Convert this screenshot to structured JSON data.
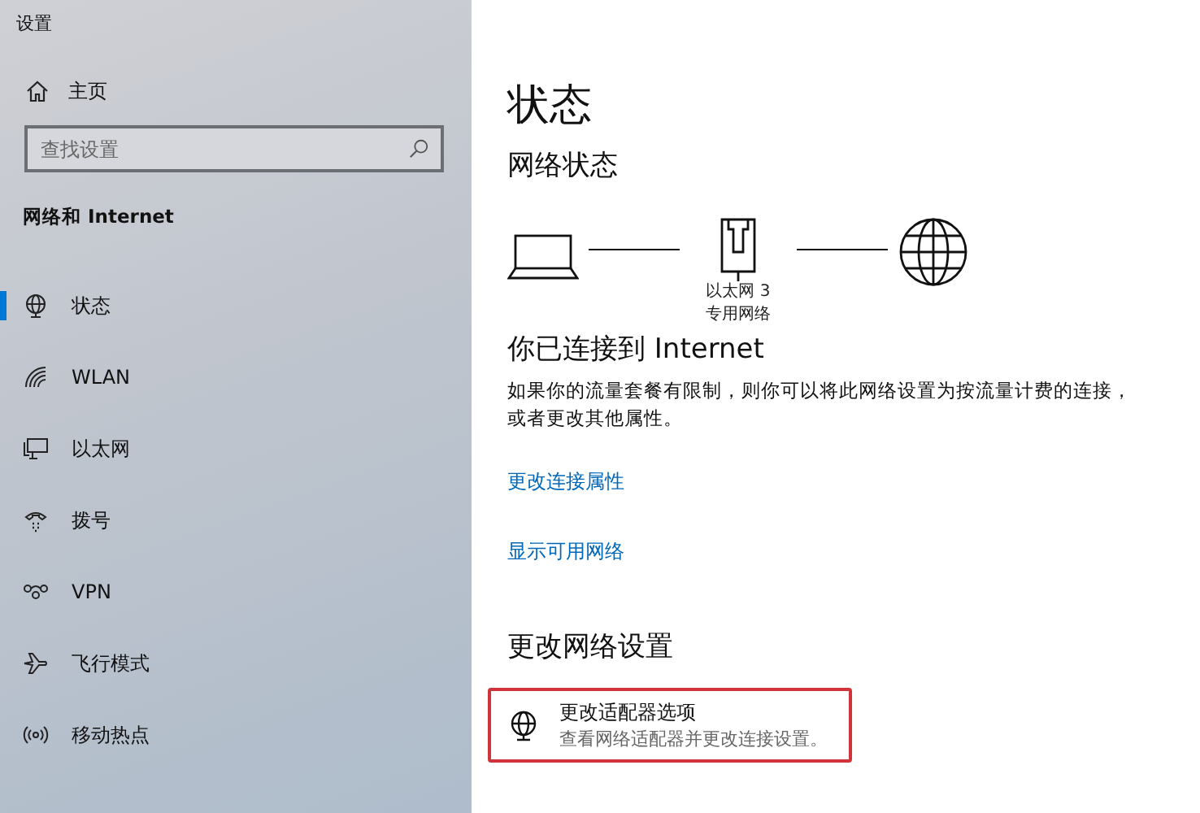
{
  "window": {
    "title": "设置"
  },
  "sidebar": {
    "home": "主页",
    "search": {
      "placeholder": "查找设置"
    },
    "section": "网络和 Internet",
    "items": [
      {
        "label": "状态",
        "selected": true
      },
      {
        "label": "WLAN",
        "selected": false
      },
      {
        "label": "以太网",
        "selected": false
      },
      {
        "label": "拨号",
        "selected": false
      },
      {
        "label": "VPN",
        "selected": false
      },
      {
        "label": "飞行模式",
        "selected": false
      },
      {
        "label": "移动热点",
        "selected": false
      }
    ]
  },
  "main": {
    "title": "状态",
    "network_heading": "网络状态",
    "adapter_name": "以太网 3",
    "network_type": "专用网络",
    "connected": "你已连接到 Internet",
    "description": "如果你的流量套餐有限制，则你可以将此网络设置为按流量计费的连接，或者更改其他属性。",
    "links": [
      "更改连接属性",
      "显示可用网络"
    ],
    "change_heading": "更改网络设置",
    "options": [
      {
        "title": "更改适配器选项",
        "subtitle": "查看网络适配器并更改连接设置。",
        "highlighted": true
      }
    ]
  }
}
